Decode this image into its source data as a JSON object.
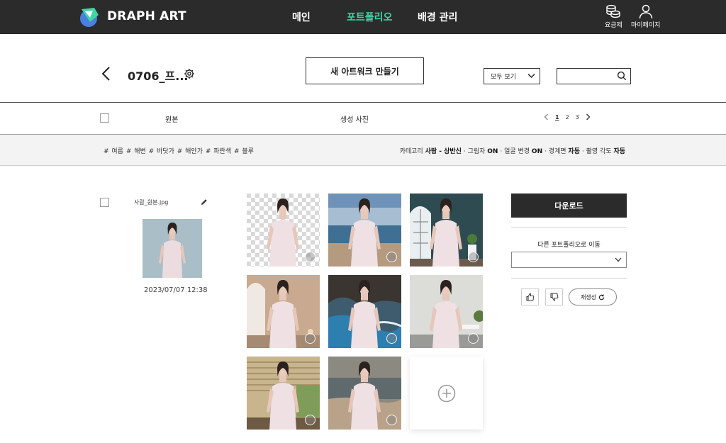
{
  "app": {
    "brand": "DRAPH ART",
    "accent_color": "#3fd6a4"
  },
  "nav": {
    "items": [
      {
        "label": "메인",
        "active": false
      },
      {
        "label": "포트폴리오",
        "active": true
      },
      {
        "label": "배경 관리",
        "active": false
      }
    ],
    "pricing_label": "요금제",
    "mypage_label": "마이페이지"
  },
  "header": {
    "portfolio_title": "0706_프...",
    "new_artwork_label": "새 아트워크 만들기",
    "view_filter": "모두 보기",
    "search_placeholder": ""
  },
  "columns": {
    "original_label": "원본",
    "generated_label": "생성 사진"
  },
  "pagination": {
    "pages": [
      "1",
      "2",
      "3"
    ],
    "current": "1"
  },
  "tags": "# 여름 # 해변 # 바닷가 # 해안가 # 파란색 # 블루",
  "options": {
    "category_label": "카테고리",
    "category_value": "사람 - 상반신",
    "shadow_label": "그림자",
    "shadow_value": "ON",
    "face_label": "얼굴 변경",
    "face_value": "ON",
    "border_label": "경계면",
    "border_value": "자동",
    "angle_label": "촬영 각도",
    "angle_value": "자동"
  },
  "original": {
    "filename": "사람_원본.jpg",
    "date": "2023/07/07 12:38"
  },
  "generated_images": [
    {
      "background": "transparent-checker"
    },
    {
      "background": "beach-sky"
    },
    {
      "background": "dark-teal-room-arched-window"
    },
    {
      "background": "beige-arch-room"
    },
    {
      "background": "rocky-sea-shore"
    },
    {
      "background": "white-interior-plant"
    },
    {
      "background": "sunlit-window-blinds"
    },
    {
      "background": "sandy-beach-waves"
    }
  ],
  "panel": {
    "download_label": "다운로드",
    "move_label": "다른 포트폴리오로 이동",
    "regenerate_label": "재생성"
  }
}
